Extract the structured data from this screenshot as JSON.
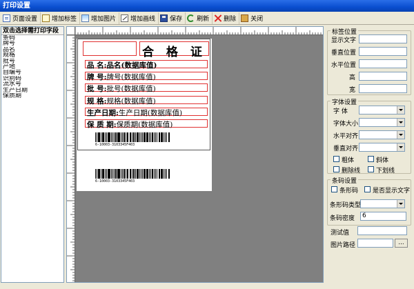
{
  "window": {
    "title": "打印设置"
  },
  "toolbar": {
    "page_setup": "页面设置",
    "add_label": "增加标签",
    "add_image": "增加图片",
    "add_line": "增加画线",
    "save": "保存",
    "refresh": "刷新",
    "delete": "删除",
    "close": "关闭"
  },
  "left_panel": {
    "header": "双击选择需打印字段",
    "fields": [
      "条码",
      "牌号",
      "品名",
      "规格",
      "批号",
      "产地",
      "自编号",
      "识别码",
      "流水号",
      "生产日期",
      "保质期"
    ]
  },
  "label": {
    "title": "合 格 证",
    "rows": [
      {
        "label": "品    名:",
        "value": "品名(数据库值)"
      },
      {
        "label": "牌    号:",
        "value": "牌号(数据库值)"
      },
      {
        "label": "批    号:",
        "value": "批号(数据库值)"
      },
      {
        "label": "规    格:",
        "value": "规格(数据库值)"
      },
      {
        "label": "生产日期:",
        "value": "生产日期(数据库值)"
      },
      {
        "label": "保 质 期:",
        "value": "保质期(数据库值)"
      }
    ],
    "barcode_text_1": "6-10003-3103345F403",
    "barcode_text_2": "6-10003-3103345F403"
  },
  "right_panel": {
    "label_position": {
      "title": "标签位置",
      "display_text": "显示文字",
      "v_pos": "垂直位置",
      "h_pos": "水平位置",
      "height": "高",
      "width": "宽"
    },
    "font_settings": {
      "title": "字体设置",
      "font": "字    体",
      "font_size": "字体大小",
      "h_align": "水平对齐",
      "v_align": "垂直对齐",
      "bold": "粗体",
      "italic": "斜体",
      "strike": "删除线",
      "underline": "下划线"
    },
    "barcode_settings": {
      "title": "条码设置",
      "barcode": "条形码",
      "show_text": "是否显示文字",
      "type": "条形码类型",
      "density": "条码密度",
      "density_value": "6"
    },
    "test_value": "测试值",
    "image_path": "图片路径",
    "browse": "..."
  }
}
